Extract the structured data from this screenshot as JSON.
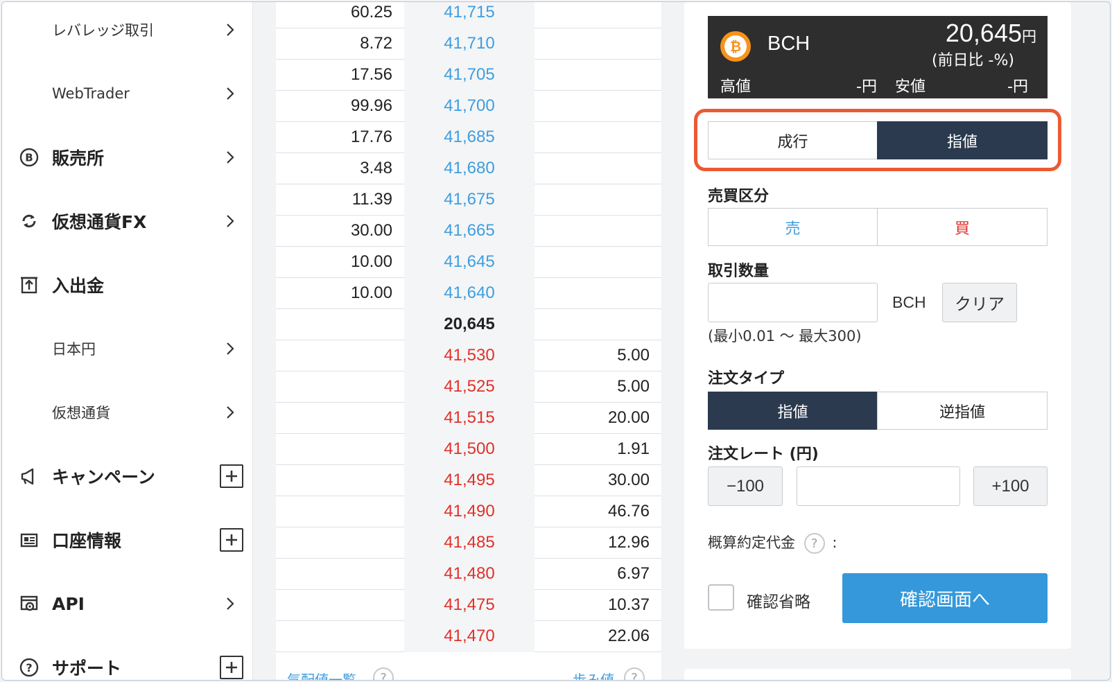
{
  "sidebar": {
    "items": [
      {
        "label": "レバレッジ取引",
        "icon": "",
        "type": "sub",
        "control": "chevron"
      },
      {
        "label": "WebTrader",
        "icon": "",
        "type": "sub",
        "control": "chevron"
      },
      {
        "label": "販売所",
        "icon": "bitcoin-circle-icon",
        "type": "main",
        "control": "chevron"
      },
      {
        "label": "仮想通貨FX",
        "icon": "exchange-arrows-icon",
        "type": "main",
        "control": "chevron"
      },
      {
        "label": "入出金",
        "icon": "deposit-box-icon",
        "type": "main",
        "control": "none"
      },
      {
        "label": "日本円",
        "icon": "",
        "type": "sub",
        "control": "chevron"
      },
      {
        "label": "仮想通貨",
        "icon": "",
        "type": "sub",
        "control": "chevron"
      },
      {
        "label": "キャンペーン",
        "icon": "megaphone-icon",
        "type": "main",
        "control": "plus"
      },
      {
        "label": "口座情報",
        "icon": "id-card-icon",
        "type": "main",
        "control": "plus"
      },
      {
        "label": "API",
        "icon": "api-gear-icon",
        "type": "main",
        "control": "chevron"
      },
      {
        "label": "サポート",
        "icon": "help-circle-icon",
        "type": "main",
        "control": "plus"
      }
    ]
  },
  "orderbook": {
    "asks": [
      {
        "amount": "60.25",
        "price": "41,715"
      },
      {
        "amount": "8.72",
        "price": "41,710"
      },
      {
        "amount": "17.56",
        "price": "41,705"
      },
      {
        "amount": "99.96",
        "price": "41,700"
      },
      {
        "amount": "17.76",
        "price": "41,685"
      },
      {
        "amount": "3.48",
        "price": "41,680"
      },
      {
        "amount": "11.39",
        "price": "41,675"
      },
      {
        "amount": "30.00",
        "price": "41,665"
      },
      {
        "amount": "10.00",
        "price": "41,645"
      },
      {
        "amount": "10.00",
        "price": "41,640"
      }
    ],
    "current_price": "20,645",
    "bids": [
      {
        "price": "41,530",
        "amount": "5.00"
      },
      {
        "price": "41,525",
        "amount": "5.00"
      },
      {
        "price": "41,515",
        "amount": "20.00"
      },
      {
        "price": "41,500",
        "amount": "1.91"
      },
      {
        "price": "41,495",
        "amount": "30.00"
      },
      {
        "price": "41,490",
        "amount": "46.76"
      },
      {
        "price": "41,485",
        "amount": "12.96"
      },
      {
        "price": "41,480",
        "amount": "6.97"
      },
      {
        "price": "41,475",
        "amount": "10.37"
      },
      {
        "price": "41,470",
        "amount": "22.06"
      }
    ],
    "footer_left": "気配値一覧",
    "footer_right": "歩み値"
  },
  "ticker": {
    "symbol": "BCH",
    "price": "20,645",
    "price_unit": "円",
    "change": "(前日比 -%)",
    "high_label": "高値",
    "high_value": "-円",
    "low_label": "安値",
    "low_value": "-円"
  },
  "order": {
    "order_kind": {
      "market": "成行",
      "limit": "指値",
      "selected": "limit"
    },
    "side_label": "売買区分",
    "side": {
      "sell": "売",
      "buy": "買"
    },
    "qty_label": "取引数量",
    "qty_value": "",
    "qty_unit": "BCH",
    "clear_label": "クリア",
    "qty_note": "(最小0.01 〜 最大300)",
    "type_label": "注文タイプ",
    "type": {
      "limit": "指値",
      "stop": "逆指値",
      "selected": "limit"
    },
    "rate_label": "注文レート (円)",
    "rate_minus": "−100",
    "rate_plus": "+100",
    "rate_value": "",
    "estimate_label": "概算約定代金",
    "estimate_suffix": ":",
    "skip_confirm_label": "確認省略",
    "confirm_button": "確認画面へ"
  },
  "colors": {
    "ask_price": "#3d9ee0",
    "bid_price": "#e1302a",
    "active_tab": "#2b3a4e",
    "confirm_button": "#3498db",
    "highlight_ring": "#eb5a32",
    "ticker_bg": "#2e2e2e"
  }
}
